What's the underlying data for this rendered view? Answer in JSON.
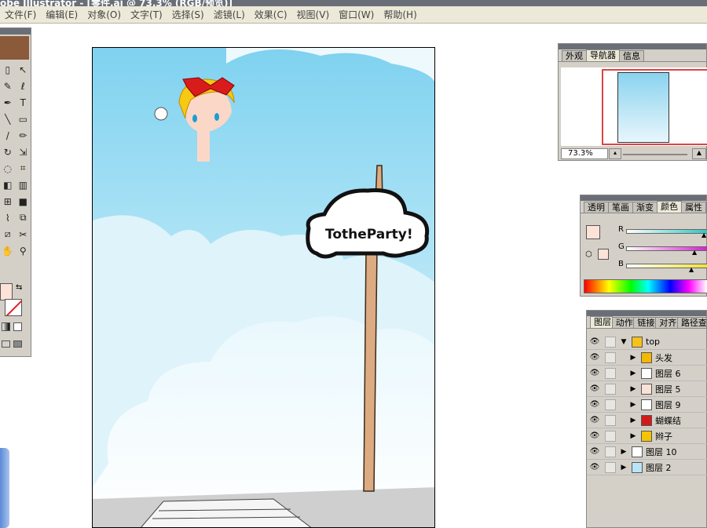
{
  "window": {
    "title": "obe Illustrator - [零件.ai @ 73.3% (RGB/预览)]"
  },
  "menu": [
    "文件(F)",
    "编辑(E)",
    "对象(O)",
    "文字(T)",
    "选择(S)",
    "滤镜(L)",
    "效果(C)",
    "视图(V)",
    "窗口(W)",
    "帮助(H)"
  ],
  "artwork": {
    "sign_text": "TotheParty!"
  },
  "navigator": {
    "tabs": [
      "外观",
      "导航器",
      "信息"
    ],
    "active_tab": 1,
    "zoom": "73.3%"
  },
  "color": {
    "tabs": [
      "透明",
      "笔画",
      "渐变",
      "颜色",
      "属性"
    ],
    "active_tab": 3,
    "channels": [
      {
        "label": "R",
        "gradient": "#2fc7c2",
        "value": 1.0
      },
      {
        "label": "G",
        "gradient": "#d61fd0",
        "value": 0.88
      },
      {
        "label": "B",
        "gradient": "#f1e23a",
        "value": 0.84
      }
    ],
    "fill": "#fde2d8"
  },
  "layers": {
    "tabs": [
      "图层",
      "动作",
      "链接",
      "对齐",
      "路径查"
    ],
    "active_tab": 0,
    "items": [
      {
        "name": "top",
        "level": 0,
        "expanded": true,
        "thumb": "#f7c11c"
      },
      {
        "name": "头发",
        "level": 1,
        "expanded": false,
        "thumb": "#f5b800"
      },
      {
        "name": "图层 6",
        "level": 1,
        "expanded": false,
        "thumb": "#ffffff"
      },
      {
        "name": "图层 5",
        "level": 1,
        "expanded": false,
        "thumb": "#fbe0d6"
      },
      {
        "name": "图层 9",
        "level": 1,
        "expanded": false,
        "thumb": "#ffffff"
      },
      {
        "name": "蝴蝶结",
        "level": 1,
        "expanded": false,
        "thumb": "#d31a1a"
      },
      {
        "name": "辫子",
        "level": 1,
        "expanded": false,
        "thumb": "#f5c400"
      },
      {
        "name": "图层 10",
        "level": 0,
        "expanded": false,
        "thumb": "#ffffff"
      },
      {
        "name": "图层 2",
        "level": 0,
        "expanded": false,
        "thumb": "#b9e4f5"
      }
    ]
  }
}
